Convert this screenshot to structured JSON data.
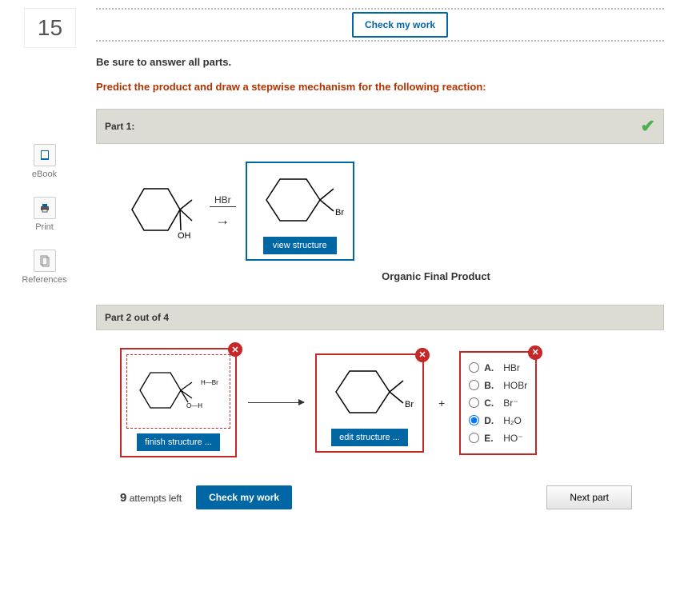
{
  "question_number": "15",
  "top_check_button": "Check my work",
  "instruction_bold": "Be sure to answer all parts.",
  "instruction_prompt": "Predict the product and draw a stepwise mechanism for the following reaction:",
  "part1": {
    "header": "Part 1:",
    "reactant_label": "OH",
    "reagent": "HBr",
    "product_label": "Br",
    "view_button": "view structure",
    "caption": "Organic Final Product"
  },
  "part2": {
    "header": "Part 2 out of 4",
    "box1_reagent": "H—Br",
    "box1_label": "O—H",
    "box1_button": "finish structure ...",
    "box2_label": "Br",
    "box2_button": "edit structure ...",
    "plus": "+",
    "options": [
      {
        "letter": "A.",
        "text": "HBr",
        "selected": false
      },
      {
        "letter": "B.",
        "text": "HOBr",
        "selected": false
      },
      {
        "letter": "C.",
        "text": "Br⁻",
        "selected": false
      },
      {
        "letter": "D.",
        "text": "H₂O",
        "selected": true
      },
      {
        "letter": "E.",
        "text": "HO⁻",
        "selected": false
      }
    ]
  },
  "footer": {
    "attempts_num": "9",
    "attempts_text": "attempts left",
    "check_button": "Check my work",
    "next_button": "Next part"
  },
  "sidebar": {
    "ebook": "eBook",
    "print": "Print",
    "references": "References"
  }
}
